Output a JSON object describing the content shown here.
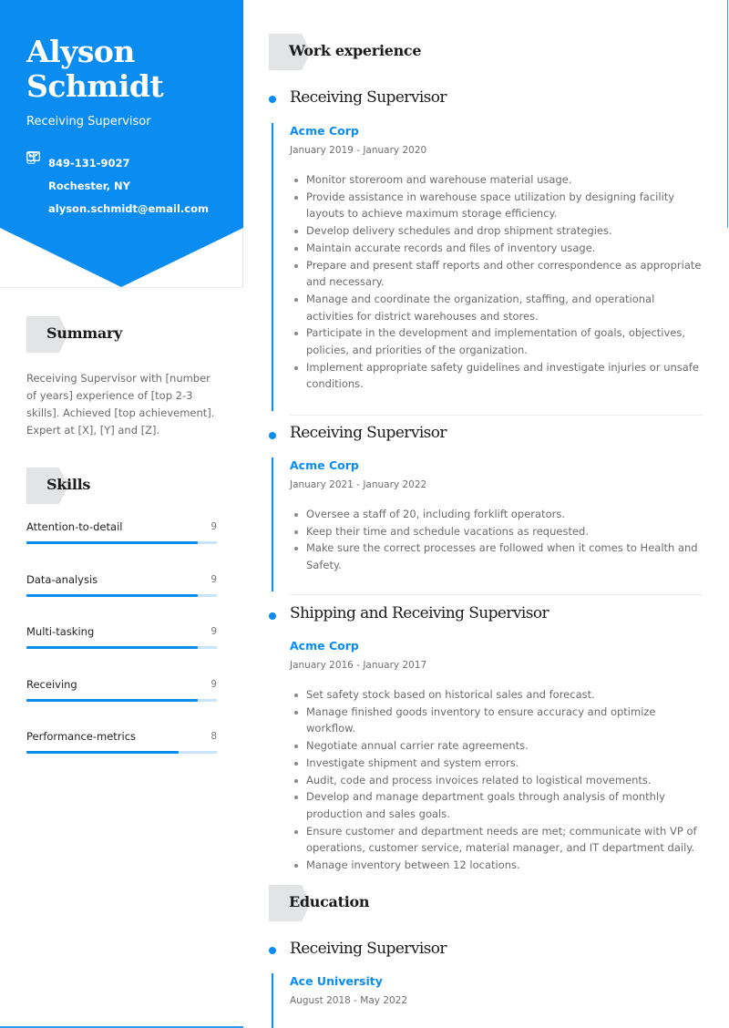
{
  "profile": {
    "first_name": "Alyson",
    "last_name": "Schmidt",
    "headline": "Receiving Supervisor",
    "contacts": [
      {
        "icon": "phone-icon",
        "value": "849-131-9027"
      },
      {
        "icon": "mailbox-icon",
        "value": "Rochester, NY"
      },
      {
        "icon": "envelope-icon",
        "value": "alyson.schmidt@email.com"
      }
    ]
  },
  "colors": {
    "accent": "#0b8cf0",
    "header_bg": "#0b8cf0",
    "section_tab": "#e3e4e6"
  },
  "summary": {
    "title": "Summary",
    "text": "Receiving Supervisor with [number of years] experience of [top 2-3 skills]. Achieved [top achievement]. Expert at [X], [Y] and [Z]."
  },
  "skills": {
    "title": "Skills",
    "max": 10,
    "items": [
      {
        "name": "Attention-to-detail",
        "score": "9",
        "level": 0.9
      },
      {
        "name": "Data-analysis",
        "score": "9",
        "level": 0.9
      },
      {
        "name": "Multi-tasking",
        "score": "9",
        "level": 0.9
      },
      {
        "name": "Receiving",
        "score": "9",
        "level": 0.9
      },
      {
        "name": "Performance-metrics",
        "score": "8",
        "level": 0.8
      }
    ]
  },
  "work": {
    "title": "Work experience",
    "entries": [
      {
        "role": "Receiving Supervisor",
        "company": "Acme Corp",
        "dates": "January 2019 - January 2020",
        "bullets": [
          "Monitor storeroom and warehouse material usage.",
          "Provide assistance in warehouse space utilization by designing facility layouts to achieve maximum storage efficiency.",
          "Develop delivery schedules and drop shipment strategies.",
          "Maintain accurate records and files of inventory usage.",
          "Prepare and present staff reports and other correspondence as appropriate and necessary.",
          "Manage and coordinate the organization, staffing, and operational activities for district warehouses and stores.",
          "Participate in the development and implementation of goals, objectives, policies, and priorities of the organization.",
          "Implement appropriate safety guidelines and investigate injuries or unsafe conditions."
        ]
      },
      {
        "role": "Receiving Supervisor",
        "company": "Acme Corp",
        "dates": "January 2021 - January 2022",
        "bullets": [
          "Oversee a staff of 20, including forklift operators.",
          "Keep their time and schedule vacations as requested.",
          "Make sure the correct processes are followed when it comes to Health and Safety."
        ]
      },
      {
        "role": "Shipping and Receiving Supervisor",
        "company": "Acme Corp",
        "dates": "January 2016 - January 2017",
        "bullets": [
          "Set safety stock based on historical sales and forecast.",
          "Manage finished goods inventory to ensure accuracy and optimize workflow.",
          "Negotiate annual carrier rate agreements.",
          "Investigate shipment and system errors.",
          "Audit, code and process invoices related to logistical movements.",
          "Develop and manage department goals through analysis of monthly production and sales goals.",
          "Ensure customer and department needs are met; communicate with VP of operations, customer service, material manager, and IT department daily.",
          "Manage inventory between 12 locations."
        ]
      }
    ]
  },
  "education": {
    "title": "Education",
    "entries": [
      {
        "degree": "Receiving Supervisor",
        "school": "Ace University",
        "dates": "August 2018 - May 2022"
      }
    ]
  }
}
